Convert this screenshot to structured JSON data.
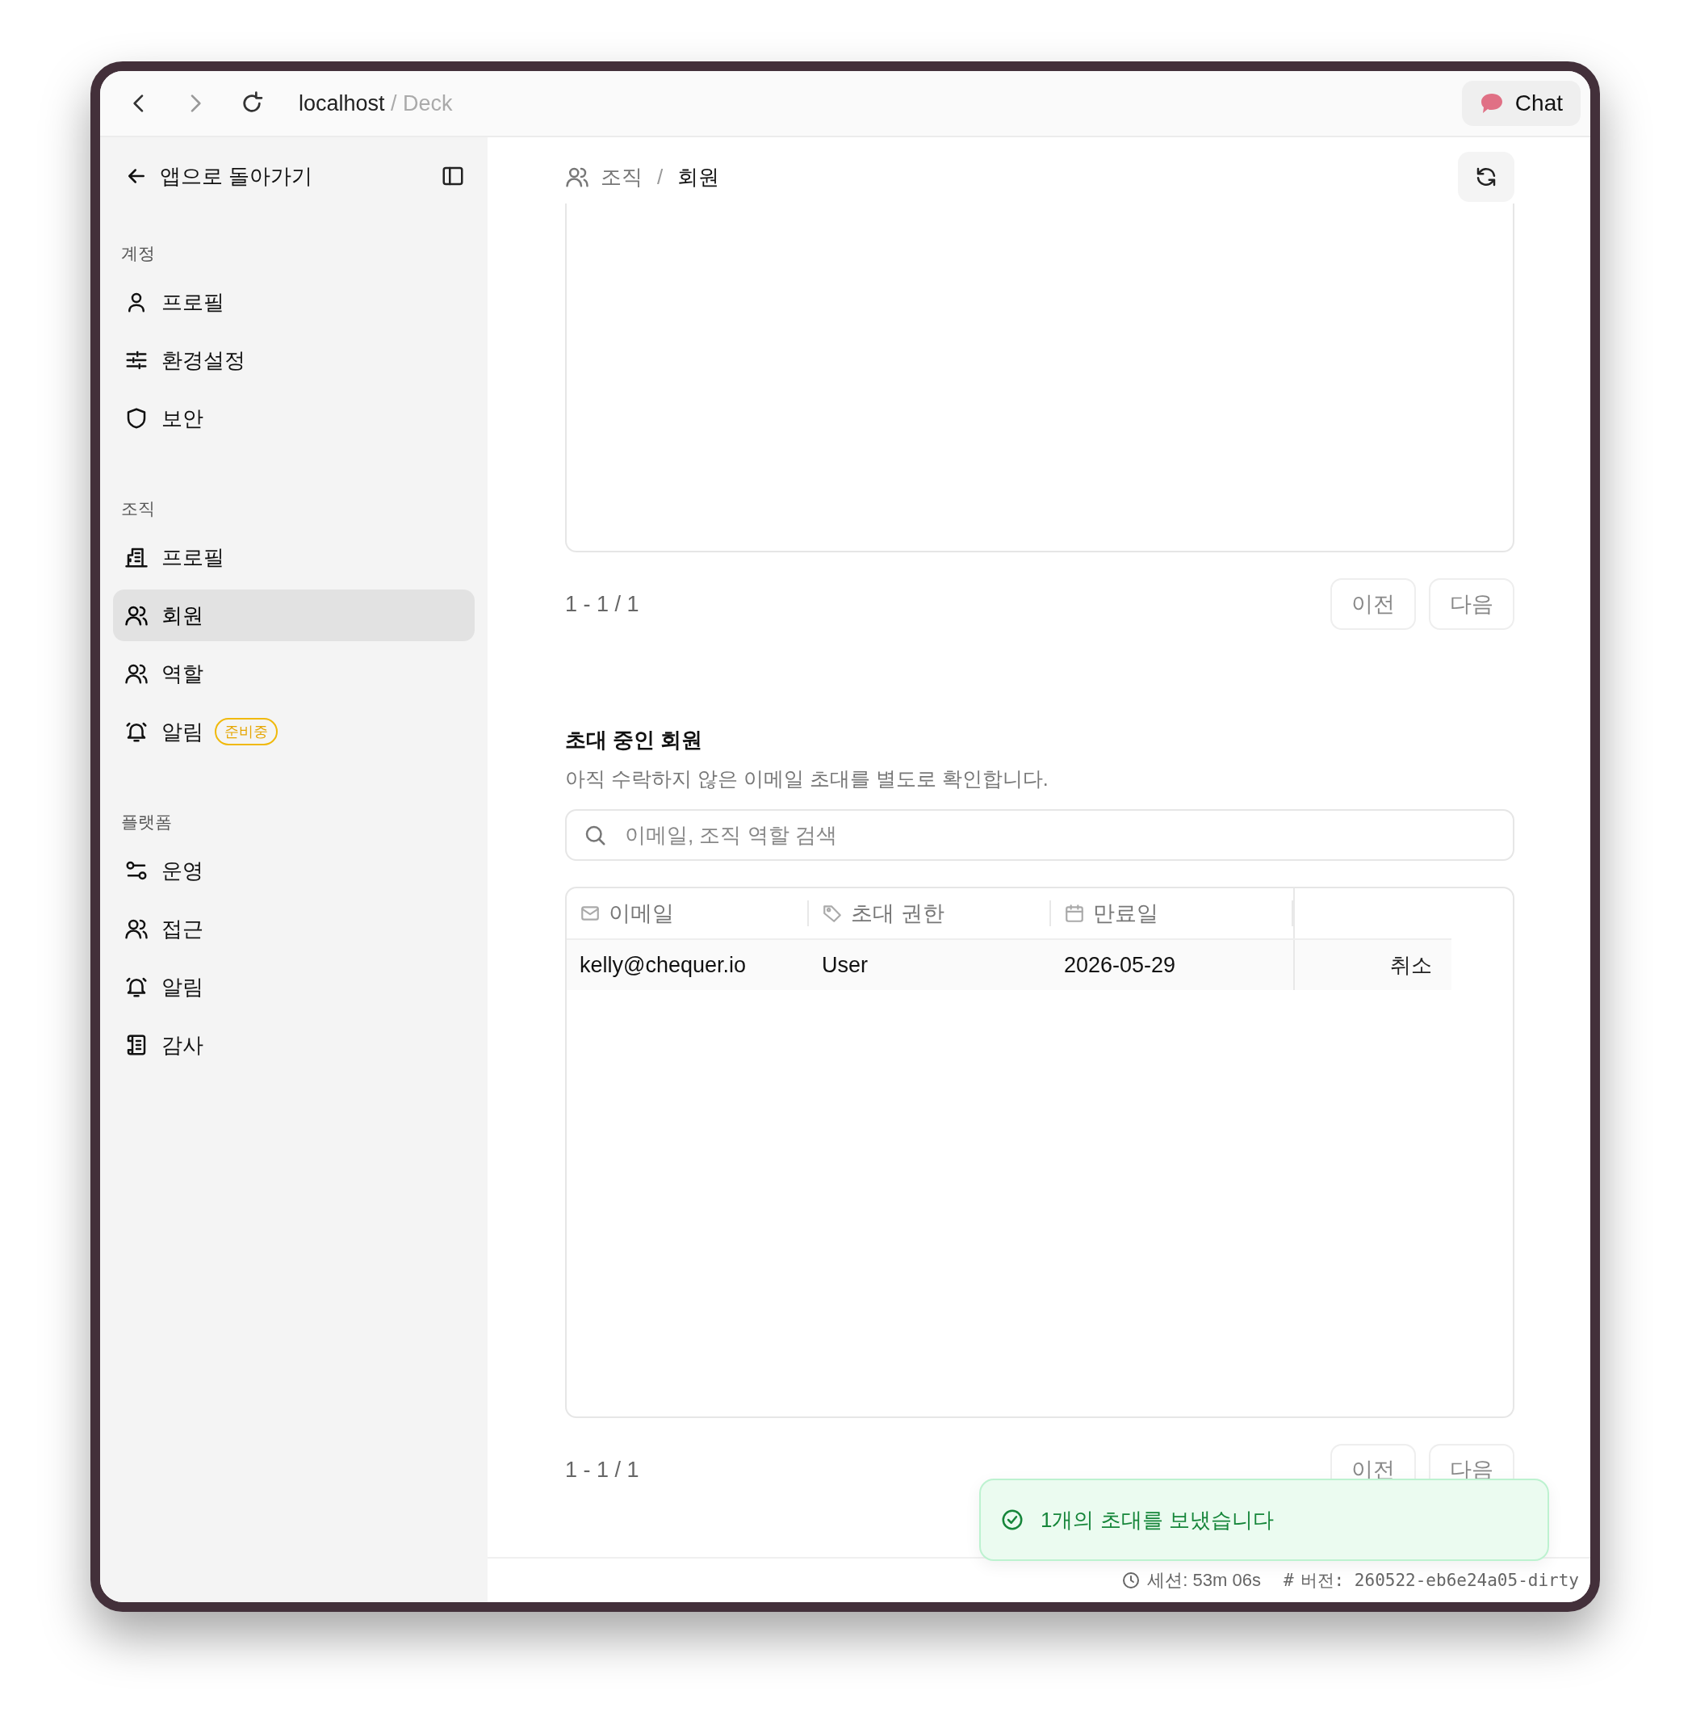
{
  "browser": {
    "host": "localhost",
    "path": "/ Deck",
    "chat_button": "Chat"
  },
  "sidebar": {
    "back_link": "앱으로 돌아가기",
    "sections": [
      {
        "title": "계정",
        "items": [
          {
            "label": "프로필",
            "selected": false
          },
          {
            "label": "환경설정",
            "selected": false
          },
          {
            "label": "보안",
            "selected": false
          }
        ]
      },
      {
        "title": "조직",
        "items": [
          {
            "label": "프로필",
            "selected": false
          },
          {
            "label": "회원",
            "selected": true
          },
          {
            "label": "역할",
            "selected": false
          },
          {
            "label": "알림",
            "selected": false,
            "badge": "준비중"
          }
        ]
      },
      {
        "title": "플랫폼",
        "items": [
          {
            "label": "운영",
            "selected": false
          },
          {
            "label": "접근",
            "selected": false
          },
          {
            "label": "알림",
            "selected": false
          },
          {
            "label": "감사",
            "selected": false
          }
        ]
      }
    ]
  },
  "breadcrumb": {
    "items": [
      "조직",
      "회원"
    ],
    "separator": "/"
  },
  "members_pagination": {
    "range": "1 - 1 / 1",
    "prev": "이전",
    "next": "다음"
  },
  "invites": {
    "title": "초대 중인 회원",
    "subtitle": "아직 수락하지 않은 이메일 초대를 별도로 확인합니다.",
    "search": {
      "placeholder": "이메일, 조직 역할 검색"
    },
    "columns": [
      "이메일",
      "초대 권한",
      "만료일"
    ],
    "rows": [
      {
        "email": "kelly@chequer.io",
        "role": "User",
        "expires": "2026-05-29",
        "action": "취소"
      }
    ],
    "pagination": {
      "range": "1 - 1 / 1",
      "prev": "이전",
      "next": "다음"
    }
  },
  "toast": {
    "message": "1개의 초대를 보냈습니다"
  },
  "status_bar": {
    "session": "세션: 53m 06s",
    "version_mark": "#",
    "version": "버전: 260522-eb6e24a05-dirty"
  }
}
